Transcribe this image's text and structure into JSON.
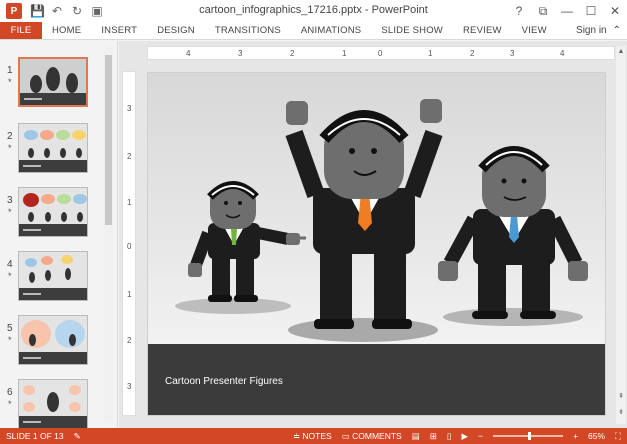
{
  "window": {
    "title": "cartoon_infographics_17216.pptx - PowerPoint",
    "controls": [
      "?",
      "⧉",
      "—",
      "☐",
      "✕"
    ]
  },
  "quick_access": {
    "app_logo": "P",
    "save_icon": "save-icon",
    "undo_icon": "undo-icon",
    "redo_icon": "redo-icon",
    "start_icon": "start-from-beginning-icon"
  },
  "ribbon": {
    "tabs": [
      "FILE",
      "HOME",
      "INSERT",
      "DESIGN",
      "TRANSITIONS",
      "ANIMATIONS",
      "SLIDE SHOW",
      "REVIEW",
      "VIEW"
    ],
    "sign_in": "Sign in",
    "collapse_glyph": "⌃"
  },
  "thumbnails": [
    {
      "num": "1",
      "star": "*"
    },
    {
      "num": "2",
      "star": "*"
    },
    {
      "num": "3",
      "star": "*"
    },
    {
      "num": "4",
      "star": "*"
    },
    {
      "num": "5",
      "star": "*"
    },
    {
      "num": "6",
      "star": "*"
    }
  ],
  "rulers": {
    "horizontal": [
      "4",
      "3",
      "2",
      "1",
      "0",
      "1",
      "2",
      "3",
      "4"
    ],
    "vertical": [
      "3",
      "2",
      "1",
      "0",
      "1",
      "2",
      "3"
    ]
  },
  "slide": {
    "caption": "Cartoon Presenter Figures"
  },
  "colors": {
    "accent": "#d24726",
    "orange_tie": "#f07c23",
    "blue_tie": "#4c9ad4",
    "green_tie": "#71b43f"
  },
  "status": {
    "slide_indicator": "SLIDE 1 OF 13",
    "notes": "NOTES",
    "comments": "COMMENTS",
    "zoom_minus": "−",
    "zoom_plus": "+",
    "zoom": "65%",
    "zoom_value": 0.52
  }
}
